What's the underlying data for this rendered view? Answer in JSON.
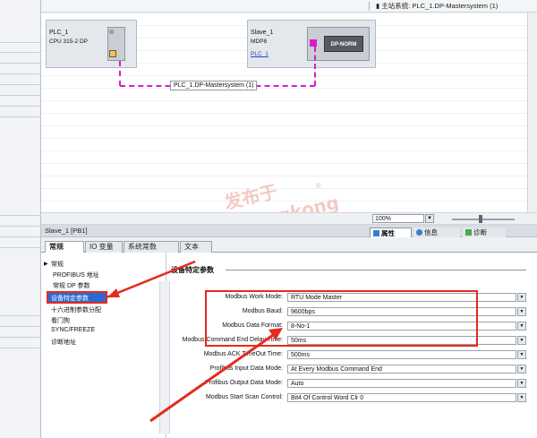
{
  "canvas": {
    "title": "主站系统: PLC_1.DP-Mastersystem (1)",
    "pin_icon": "pin-icon"
  },
  "devices": {
    "plc": {
      "name": "PLC_1",
      "type": "CPU 315-2 DP"
    },
    "slave": {
      "name": "Slave_1",
      "type": "MDP8",
      "link": "PLC_1",
      "module_label": "DP-NORM"
    }
  },
  "bus": {
    "label": "PLC_1.DP-Mastersystem (1)"
  },
  "zoom": {
    "value": "100%"
  },
  "properties": {
    "title": "Slave_1 [PB1]",
    "tabs": {
      "props": "属性",
      "info": "信息",
      "diag": "诊断"
    }
  },
  "main_tabs": [
    "常规",
    "IO 变量",
    "系统常数",
    "文本"
  ],
  "nav": {
    "items": [
      "常规",
      "PROFIBUS 地址",
      "常规 DP 参数",
      "设备特定参数",
      "十六进制参数分配",
      "看门狗",
      "SYNC/FREEZE",
      "诊断地址"
    ],
    "selected_index": 3
  },
  "section": {
    "title": "设备特定参数"
  },
  "params": [
    {
      "label": "Modbus Work Mode:",
      "value": "RTU Mode Master"
    },
    {
      "label": "Modbus Baud:",
      "value": "9600bps"
    },
    {
      "label": "Modbus Data Format:",
      "value": "8-No-1"
    },
    {
      "label": "Modbus Command End Delay Time:",
      "value": "50ms"
    },
    {
      "label": "Modbus ACK TimeOut Time:",
      "value": "500ms"
    },
    {
      "label": "Profibus Input Data Mode:",
      "value": "At Every Modbus Command End"
    },
    {
      "label": "Profibus Output Data Mode:",
      "value": "Auto"
    },
    {
      "label": "Modbus Start Scan Control:",
      "value": "Bit4 Of Control Word Clr 0"
    }
  ],
  "watermark": {
    "line1": "发布于",
    "line2": "gongkong",
    "mark": "®"
  },
  "colors": {
    "profibus": "#d41ec8",
    "annotation": "#e52a1e",
    "selection": "#2b6ad0"
  }
}
